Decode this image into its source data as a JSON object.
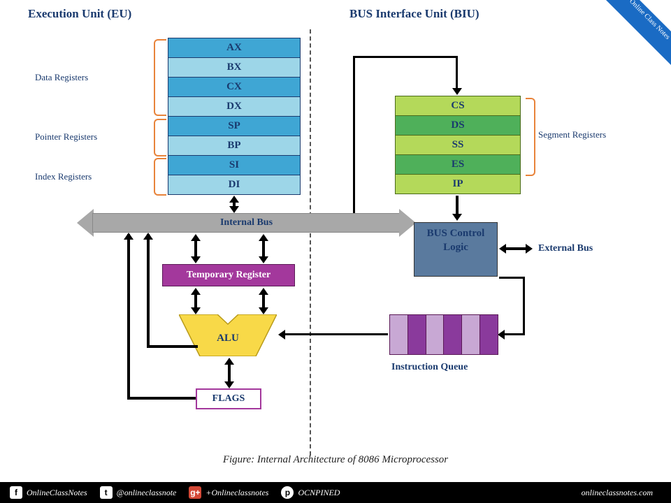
{
  "header": {
    "eu": "Execution Unit (EU)",
    "biu": "BUS Interface Unit (BIU)"
  },
  "eu_registers": {
    "data_label": "Data Registers",
    "pointer_label": "Pointer Registers",
    "index_label": "Index Registers",
    "regs": [
      "AX",
      "BX",
      "CX",
      "DX",
      "SP",
      "BP",
      "SI",
      "DI"
    ]
  },
  "internal_bus": "Internal Bus",
  "temp_register": "Temporary Register",
  "alu": "ALU",
  "flags": "FLAGS",
  "biu_registers": {
    "label": "Segment Registers",
    "regs": [
      "CS",
      "DS",
      "SS",
      "ES",
      "IP"
    ]
  },
  "bus_control": "BUS Control Logic",
  "external_bus": "External Bus",
  "instruction_queue": "Instruction Queue",
  "caption": "Figure: Internal Architecture of 8086 Microprocessor",
  "footer": {
    "fb": "OnlineClassNotes",
    "tw": "@onlineclassnote",
    "gp": "+Onlineclassnotes",
    "pn": "OCNPINED",
    "site": "onlineclassnotes.com"
  },
  "badge": "Online Class Notes"
}
